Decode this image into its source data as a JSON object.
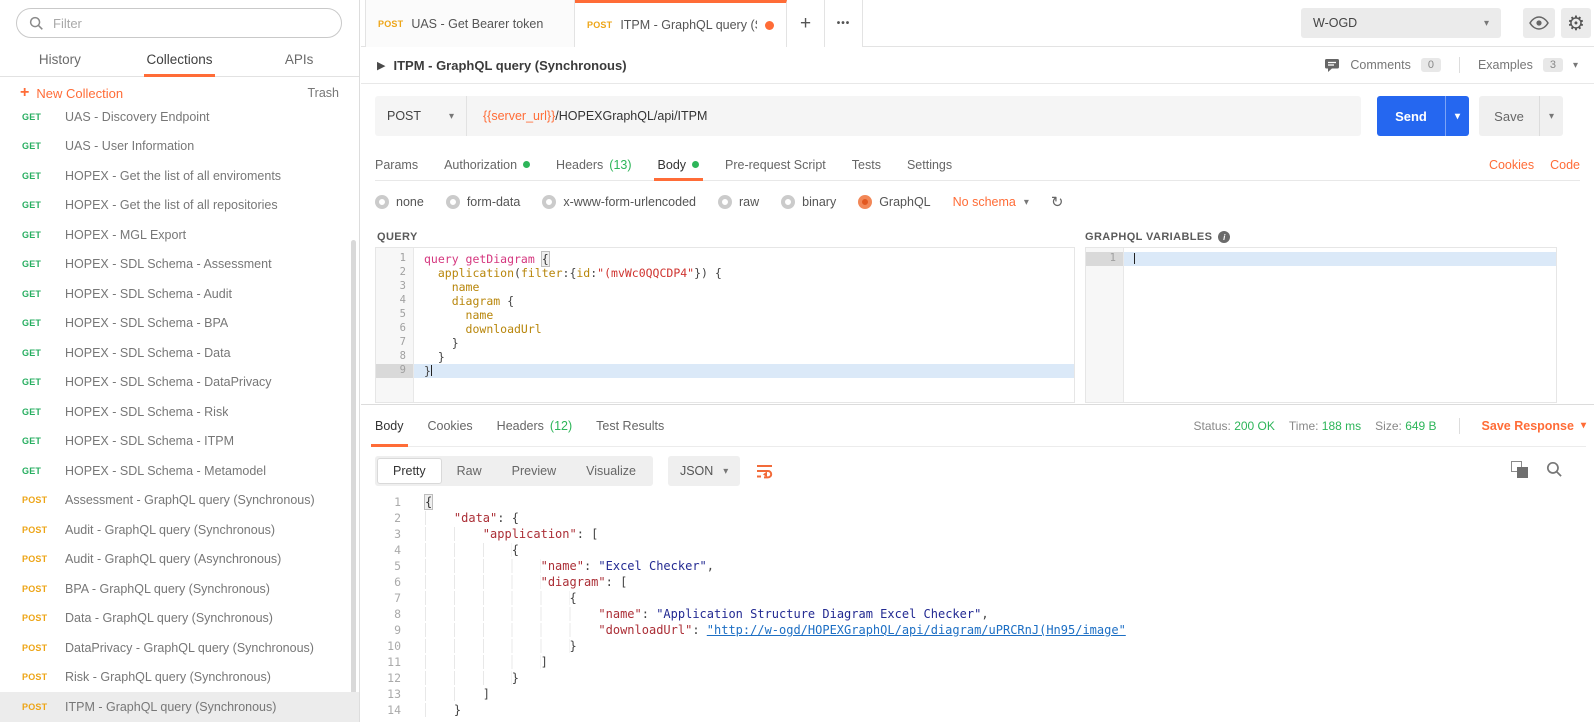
{
  "colors": {
    "accent": "#ff6c37",
    "send_button": "#2567f0",
    "get_badge": "#27ae60",
    "post_badge": "#eda517",
    "success_green": "#2db559"
  },
  "sidebar": {
    "filter_placeholder": "Filter",
    "tabs": {
      "history": "History",
      "collections": "Collections",
      "apis": "APIs"
    },
    "new_collection_label": "New Collection",
    "trash_label": "Trash",
    "items": [
      {
        "method": "GET",
        "label": "UAS - Discovery Endpoint"
      },
      {
        "method": "GET",
        "label": "UAS - User Information"
      },
      {
        "method": "GET",
        "label": "HOPEX - Get the list of all enviroments"
      },
      {
        "method": "GET",
        "label": "HOPEX - Get the list of all repositories"
      },
      {
        "method": "GET",
        "label": "HOPEX - MGL Export"
      },
      {
        "method": "GET",
        "label": "HOPEX - SDL Schema - Assessment"
      },
      {
        "method": "GET",
        "label": "HOPEX - SDL Schema - Audit"
      },
      {
        "method": "GET",
        "label": "HOPEX - SDL Schema - BPA"
      },
      {
        "method": "GET",
        "label": "HOPEX - SDL Schema - Data"
      },
      {
        "method": "GET",
        "label": "HOPEX - SDL Schema - DataPrivacy"
      },
      {
        "method": "GET",
        "label": "HOPEX - SDL Schema - Risk"
      },
      {
        "method": "GET",
        "label": "HOPEX - SDL Schema - ITPM"
      },
      {
        "method": "GET",
        "label": "HOPEX - SDL Schema - Metamodel"
      },
      {
        "method": "POST",
        "label": "Assessment - GraphQL query (Synchronous)"
      },
      {
        "method": "POST",
        "label": "Audit - GraphQL query (Synchronous)"
      },
      {
        "method": "POST",
        "label": "Audit - GraphQL query (Asynchronous)"
      },
      {
        "method": "POST",
        "label": "BPA - GraphQL query (Synchronous)"
      },
      {
        "method": "POST",
        "label": "Data - GraphQL query (Synchronous)"
      },
      {
        "method": "POST",
        "label": "DataPrivacy - GraphQL query (Synchronous)"
      },
      {
        "method": "POST",
        "label": "Risk - GraphQL query (Synchronous)"
      },
      {
        "method": "POST",
        "label": "ITPM - GraphQL query (Synchronous)",
        "selected": true
      }
    ]
  },
  "header": {
    "tabs": [
      {
        "method": "POST",
        "label": "UAS - Get Bearer token"
      },
      {
        "method": "POST",
        "label": "ITPM - GraphQL query (Synchr..."
      }
    ],
    "new_tab_label": "+",
    "more_label": "•••",
    "environment": "W-OGD"
  },
  "request": {
    "title": "ITPM - GraphQL query (Synchronous)",
    "comments_label": "Comments",
    "comments_count": "0",
    "examples_label": "Examples",
    "examples_count": "3",
    "method": "POST",
    "url_variable": "{{server_url}}",
    "url_path": "/HOPEXGraphQL/api/ITPM",
    "send_label": "Send",
    "save_label": "Save",
    "tab_params": "Params",
    "tab_authorization": "Authorization",
    "tab_headers": "Headers",
    "headers_count": "(13)",
    "tab_body": "Body",
    "tab_prerequest": "Pre-request Script",
    "tab_tests": "Tests",
    "tab_settings": "Settings",
    "cookies_link": "Cookies",
    "code_link": "Code",
    "body_modes": [
      {
        "label": "none"
      },
      {
        "label": "form-data"
      },
      {
        "label": "x-www-form-urlencoded"
      },
      {
        "label": "raw"
      },
      {
        "label": "binary"
      },
      {
        "label": "GraphQL",
        "selected": true
      }
    ],
    "schema_label": "No schema",
    "query_panel_label": "QUERY",
    "variables_panel_label": "GRAPHQL VARIABLES",
    "query_lines": [
      {
        "n": "1",
        "tokens": [
          [
            "kw",
            "query getDiagram"
          ],
          [
            "pu",
            " "
          ],
          [
            "bm",
            "{"
          ]
        ]
      },
      {
        "n": "2",
        "tokens": [
          [
            "pu",
            "  "
          ],
          [
            "fld",
            "application"
          ],
          [
            "pu",
            "("
          ],
          [
            "fld",
            "filter"
          ],
          [
            "pu",
            ":{"
          ],
          [
            "fld",
            "id"
          ],
          [
            "pu",
            ":"
          ],
          [
            "str",
            "\"(mvWc0QQCDP4\""
          ],
          [
            "pu",
            "}) {"
          ]
        ]
      },
      {
        "n": "3",
        "tokens": [
          [
            "pu",
            "    "
          ],
          [
            "fld",
            "name"
          ]
        ]
      },
      {
        "n": "4",
        "tokens": [
          [
            "pu",
            "    "
          ],
          [
            "fld",
            "diagram"
          ],
          [
            "pu",
            " {"
          ]
        ]
      },
      {
        "n": "5",
        "tokens": [
          [
            "pu",
            "      "
          ],
          [
            "fld",
            "name"
          ]
        ]
      },
      {
        "n": "6",
        "tokens": [
          [
            "pu",
            "      "
          ],
          [
            "fld",
            "downloadUrl"
          ]
        ]
      },
      {
        "n": "7",
        "tokens": [
          [
            "pu",
            "    }"
          ]
        ]
      },
      {
        "n": "8",
        "tokens": [
          [
            "pu",
            "  }"
          ]
        ]
      },
      {
        "n": "9",
        "active": true,
        "tokens": [
          [
            "pu",
            "}"
          ],
          [
            "cur",
            ""
          ]
        ]
      }
    ],
    "variables_lines": [
      {
        "n": "1",
        "active": true,
        "tokens": [
          [
            "cur",
            ""
          ]
        ]
      }
    ]
  },
  "response": {
    "tab_body": "Body",
    "tab_cookies": "Cookies",
    "tab_headers": "Headers",
    "headers_count": "(12)",
    "tab_test_results": "Test Results",
    "status_label": "Status:",
    "status_value": "200 OK",
    "time_label": "Time:",
    "time_value": "188 ms",
    "size_label": "Size:",
    "size_value": "649 B",
    "save_response_label": "Save Response",
    "view_modes": [
      {
        "label": "Pretty",
        "selected": true
      },
      {
        "label": "Raw"
      },
      {
        "label": "Preview"
      },
      {
        "label": "Visualize"
      }
    ],
    "format_label": "JSON",
    "body_lines": [
      {
        "n": "1",
        "tokens": [
          [
            "bm",
            "{"
          ]
        ]
      },
      {
        "n": "2",
        "tokens": [
          [
            "ind",
            "    "
          ],
          [
            "key",
            "\"data\""
          ],
          [
            "pu",
            ": {"
          ]
        ]
      },
      {
        "n": "3",
        "tokens": [
          [
            "ind",
            "        "
          ],
          [
            "key",
            "\"application\""
          ],
          [
            "pu",
            ": ["
          ]
        ]
      },
      {
        "n": "4",
        "tokens": [
          [
            "ind",
            "            "
          ],
          [
            "pu",
            "{"
          ]
        ]
      },
      {
        "n": "5",
        "tokens": [
          [
            "ind",
            "                "
          ],
          [
            "key",
            "\"name\""
          ],
          [
            "pu",
            ": "
          ],
          [
            "jstr",
            "\"Excel Checker\""
          ],
          [
            "pu",
            ","
          ]
        ]
      },
      {
        "n": "6",
        "tokens": [
          [
            "ind",
            "                "
          ],
          [
            "key",
            "\"diagram\""
          ],
          [
            "pu",
            ": ["
          ]
        ]
      },
      {
        "n": "7",
        "tokens": [
          [
            "ind",
            "                    "
          ],
          [
            "pu",
            "{"
          ]
        ]
      },
      {
        "n": "8",
        "tokens": [
          [
            "ind",
            "                        "
          ],
          [
            "key",
            "\"name\""
          ],
          [
            "pu",
            ": "
          ],
          [
            "jstr",
            "\"Application Structure Diagram Excel Checker\""
          ],
          [
            "pu",
            ","
          ]
        ]
      },
      {
        "n": "9",
        "tokens": [
          [
            "ind",
            "                        "
          ],
          [
            "key",
            "\"downloadUrl\""
          ],
          [
            "pu",
            ": "
          ],
          [
            "lnk",
            "\"http://w-ogd/HOPEXGraphQL/api/diagram/uPRCRnJ(Hn95/image\""
          ]
        ]
      },
      {
        "n": "10",
        "tokens": [
          [
            "ind",
            "                    "
          ],
          [
            "pu",
            "}"
          ]
        ]
      },
      {
        "n": "11",
        "tokens": [
          [
            "ind",
            "                "
          ],
          [
            "pu",
            "]"
          ]
        ]
      },
      {
        "n": "12",
        "tokens": [
          [
            "ind",
            "            "
          ],
          [
            "pu",
            "}"
          ]
        ]
      },
      {
        "n": "13",
        "tokens": [
          [
            "ind",
            "        "
          ],
          [
            "pu",
            "]"
          ]
        ]
      },
      {
        "n": "14",
        "tokens": [
          [
            "ind",
            "    "
          ],
          [
            "pu",
            "}"
          ]
        ]
      }
    ]
  }
}
